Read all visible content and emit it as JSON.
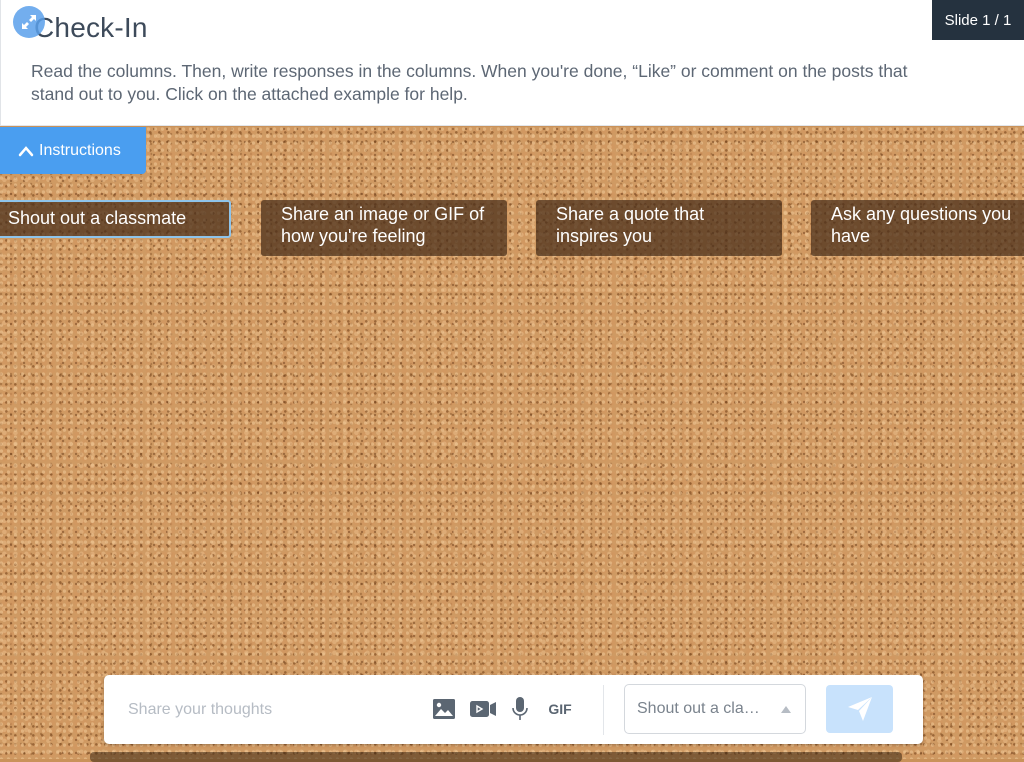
{
  "header": {
    "title": "Check-In",
    "instructions": "Read the columns. Then, write responses in the columns. When you're done, “Like” or comment on the posts that stand out to you. Click on the attached example for help.",
    "slide_indicator": "Slide 1 / 1",
    "expand_icon": "expand-arrows-icon"
  },
  "instructions_toggle": {
    "label": "Instructions",
    "icon": "chevron-up-icon"
  },
  "columns": [
    {
      "label": "Shout out a classmate",
      "selected": true
    },
    {
      "label": "Share an image or GIF of how you're feeling",
      "selected": false
    },
    {
      "label": "Share a quote that inspires you",
      "selected": false
    },
    {
      "label": "Ask any questions you have",
      "selected": false
    }
  ],
  "compose": {
    "placeholder": "Share your thoughts",
    "value": "",
    "tools": [
      {
        "name": "image-icon"
      },
      {
        "name": "video-icon"
      },
      {
        "name": "microphone-icon"
      },
      {
        "name": "gif",
        "label": "GIF"
      }
    ],
    "column_select": {
      "selected": "Shout out a cla…",
      "caret": "caret-up-icon"
    },
    "send_icon": "paper-plane-icon"
  },
  "colors": {
    "accent": "#4a9ef0",
    "slide_badge_bg": "#25323f",
    "send_button_bg": "#c8e2fc",
    "column_header_bg": "#46301c",
    "selected_outline": "#8fc4ea"
  }
}
